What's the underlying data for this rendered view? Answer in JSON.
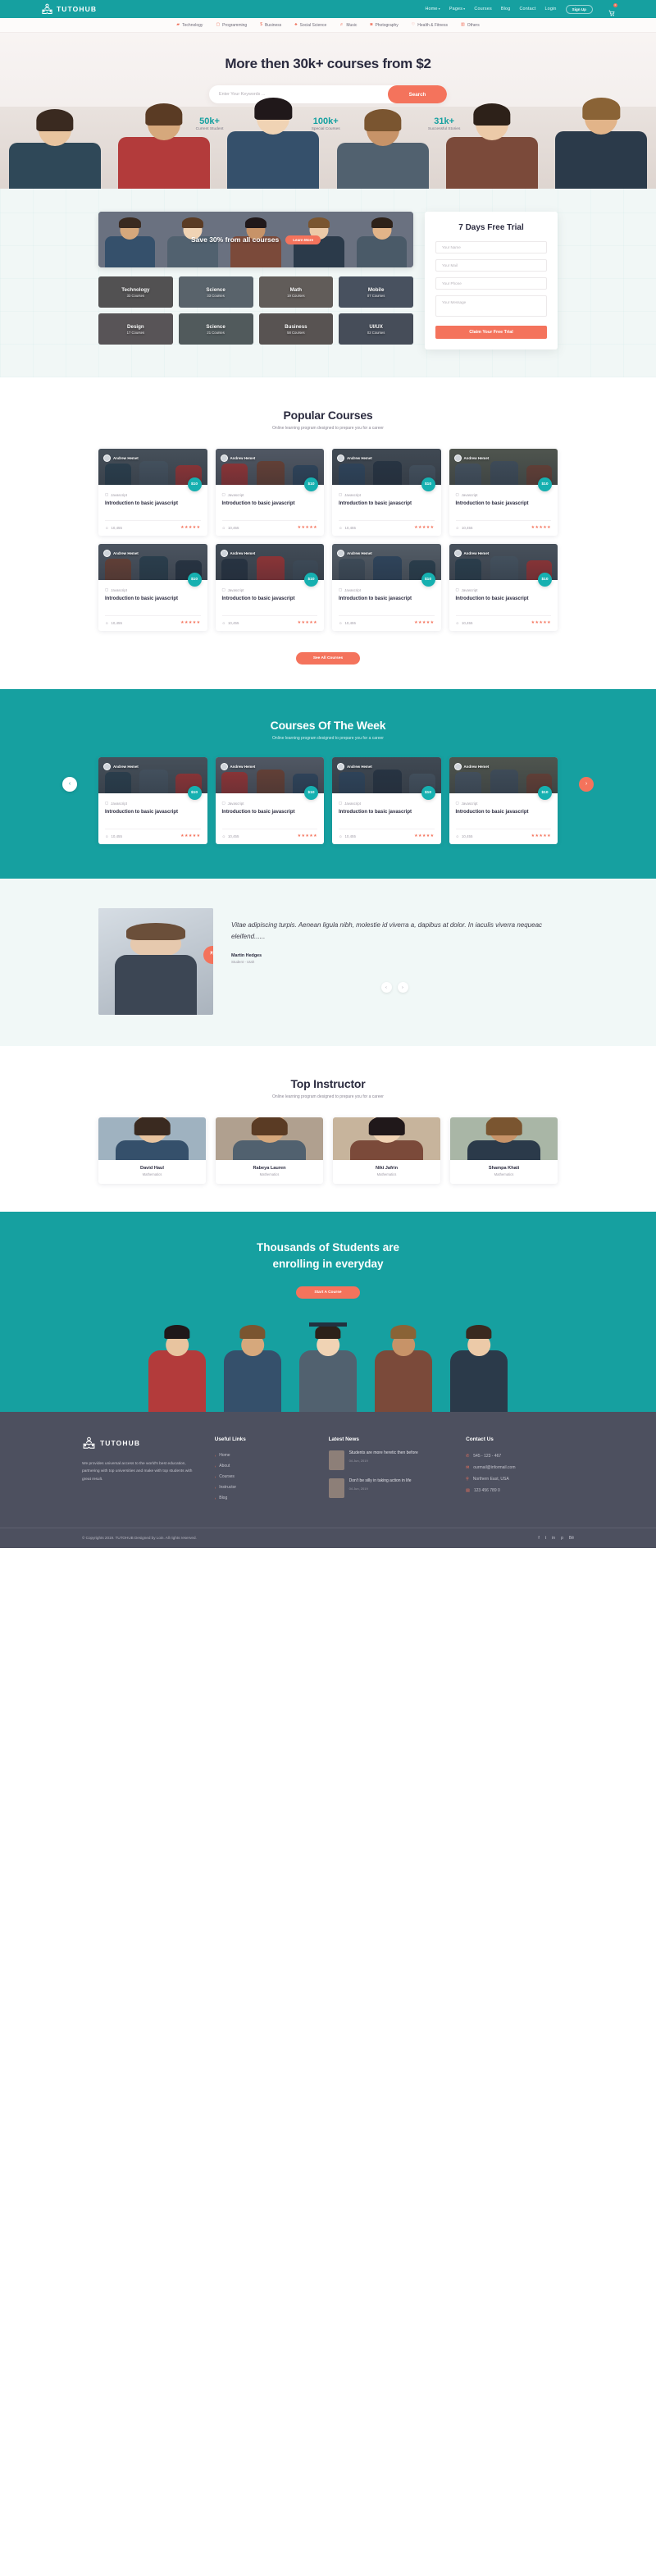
{
  "brand": {
    "name": "TUTOHUB",
    "logo_icon": "reading-person-book-icon"
  },
  "header": {
    "nav": [
      {
        "label": "Home",
        "has_dropdown": true
      },
      {
        "label": "Pages",
        "has_dropdown": true
      },
      {
        "label": "Courses",
        "has_dropdown": false
      },
      {
        "label": "Blog",
        "has_dropdown": false
      },
      {
        "label": "Contact",
        "has_dropdown": false
      }
    ],
    "login_label": "Login",
    "signup_label": "Sign Up",
    "cart_icon": "shopping-cart-icon",
    "cart_count": "0"
  },
  "categories": [
    {
      "label": "Technology",
      "icon": "laptop-icon"
    },
    {
      "label": "Programming",
      "icon": "code-window-icon"
    },
    {
      "label": "Business",
      "icon": "dollar-icon"
    },
    {
      "label": "Social Science",
      "icon": "users-icon"
    },
    {
      "label": "Music",
      "icon": "music-note-icon"
    },
    {
      "label": "Photography",
      "icon": "camera-icon"
    },
    {
      "label": "Health & Fitness",
      "icon": "heart-icon"
    },
    {
      "label": "Others",
      "icon": "grid-icon"
    }
  ],
  "hero": {
    "heading": "More then 30k+ courses from $2",
    "search_placeholder": "Enter Your Keywords ...",
    "search_value": "",
    "search_button": "Search",
    "stats": [
      {
        "value": "50k+",
        "label": "Current Student"
      },
      {
        "value": "100k+",
        "label": "Special Courses"
      },
      {
        "value": "31k+",
        "label": "Successful Stories"
      }
    ]
  },
  "promo": {
    "banner_text": "Save 30% from all courses",
    "banner_button": "Learn More",
    "tiles": [
      {
        "name": "Technology",
        "count": "33 Courses"
      },
      {
        "name": "Science",
        "count": "33 Courses"
      },
      {
        "name": "Math",
        "count": "19 Courses"
      },
      {
        "name": "Mobile",
        "count": "07 Courses"
      },
      {
        "name": "Design",
        "count": "17 Courses"
      },
      {
        "name": "Science",
        "count": "21 Courses"
      },
      {
        "name": "Business",
        "count": "58 Courses"
      },
      {
        "name": "UI/UX",
        "count": "02 Courses"
      }
    ],
    "trial": {
      "title": "7 Days Free Trial",
      "name_placeholder": "Your Name",
      "mail_placeholder": "Your Mail",
      "phone_placeholder": "Your Phone",
      "message_placeholder": "Your Message",
      "submit_label": "Claim Your Free Trial"
    }
  },
  "popular": {
    "title": "Popular Courses",
    "subtitle": "Online learning program designed to prepare you for a career",
    "see_all_label": "See All Courses",
    "cards": [
      {
        "tutor": "Andrew Hemet",
        "category": "Javascript",
        "title": "Introduction to basic javascript",
        "price": "$10",
        "students": "10,455",
        "rating": "5"
      },
      {
        "tutor": "Andrew Hemet",
        "category": "Javascript",
        "title": "Introduction to basic javascript",
        "price": "$10",
        "students": "10,455",
        "rating": "5"
      },
      {
        "tutor": "Andrew Hemet",
        "category": "Javascript",
        "title": "Introduction to basic javascript",
        "price": "$10",
        "students": "10,455",
        "rating": "5"
      },
      {
        "tutor": "Andrew Hemet",
        "category": "Javascript",
        "title": "Introduction to basic javascript",
        "price": "$10",
        "students": "10,455",
        "rating": "5"
      },
      {
        "tutor": "Andrew Hemet",
        "category": "Javascript",
        "title": "Introduction to basic javascript",
        "price": "$10",
        "students": "10,455",
        "rating": "5"
      },
      {
        "tutor": "Andrew Hemet",
        "category": "Javascript",
        "title": "Introduction to basic javascript",
        "price": "$10",
        "students": "10,455",
        "rating": "5"
      },
      {
        "tutor": "Andrew Hemet",
        "category": "Javascript",
        "title": "Introduction to basic javascript",
        "price": "$10",
        "students": "10,455",
        "rating": "5"
      },
      {
        "tutor": "Andrew Hemet",
        "category": "Javascript",
        "title": "Introduction to basic javascript",
        "price": "$10",
        "students": "10,455",
        "rating": "5"
      }
    ]
  },
  "week": {
    "title": "Courses Of The Week",
    "subtitle": "Online learning program designed to prepare you for a career",
    "prev_icon": "chevron-left-icon",
    "next_icon": "chevron-right-icon",
    "cards": [
      {
        "tutor": "Andrew Hemet",
        "category": "Javascript",
        "title": "Introduction to basic javascript",
        "price": "$10",
        "students": "10,455",
        "rating": "5"
      },
      {
        "tutor": "Andrew Hemet",
        "category": "Javascript",
        "title": "Introduction to basic javascript",
        "price": "$10",
        "students": "10,455",
        "rating": "5"
      },
      {
        "tutor": "Andrew Hemet",
        "category": "Javascript",
        "title": "Introduction to basic javascript",
        "price": "$10",
        "students": "10,455",
        "rating": "5"
      },
      {
        "tutor": "Andrew Hemet",
        "category": "Javascript",
        "title": "Introduction to basic javascript",
        "price": "$10",
        "students": "10,455",
        "rating": "5"
      }
    ]
  },
  "testimonial": {
    "quote": "Vitae adipiscing turpis. Aenean ligula nibh, molestie id viverra a, dapibus at dolor. In iaculis viverra nequeac eleifend......",
    "name": "Martin Hedges",
    "role": "Student - Utah",
    "prev_icon": "chevron-left-icon",
    "next_icon": "chevron-right-icon"
  },
  "instructors": {
    "title": "Top Instructor",
    "subtitle": "Online learning program designed to prepare you for a career",
    "people": [
      {
        "name": "David Haul",
        "role": "Mathematics"
      },
      {
        "name": "Rabeya Lauren",
        "role": "Mathematics"
      },
      {
        "name": "Niki Jafrin",
        "role": "Mathematics"
      },
      {
        "name": "Shampa Khati",
        "role": "Mathematics"
      }
    ]
  },
  "cta": {
    "line1": "Thousands of Students are",
    "line2": "enrolling in everyday",
    "button": "Start A Course"
  },
  "footer": {
    "about": "We provides universal access to the world's best education, partnering with top universities and make with top students with great result.",
    "useful_links_title": "Useful Links",
    "useful_links": [
      "Home",
      "About",
      "Courses",
      "Instructor",
      "Blog"
    ],
    "news_title": "Latest News",
    "news": [
      {
        "title": "Students are more heretic then before",
        "date": "04 Jun, 2019"
      },
      {
        "title": "Don't be silly in taking action in life",
        "date": "04 Jun, 2019"
      }
    ],
    "contact_title": "Contact Us",
    "contacts": [
      {
        "icon": "phone-icon",
        "value": "545 - 123 - 467"
      },
      {
        "icon": "mail-icon",
        "value": "ourmail@informail.com"
      },
      {
        "icon": "location-pin-icon",
        "value": "Northern East, USA"
      },
      {
        "icon": "fax-icon",
        "value": "123 456 789 0"
      }
    ],
    "copyright": "© Copyrights 2019. TUTOHUB Designed by Loin. All rights reserved.",
    "socials": [
      "facebook-icon",
      "twitter-icon",
      "linkedin-icon",
      "pinterest-icon",
      "behance-icon"
    ]
  }
}
